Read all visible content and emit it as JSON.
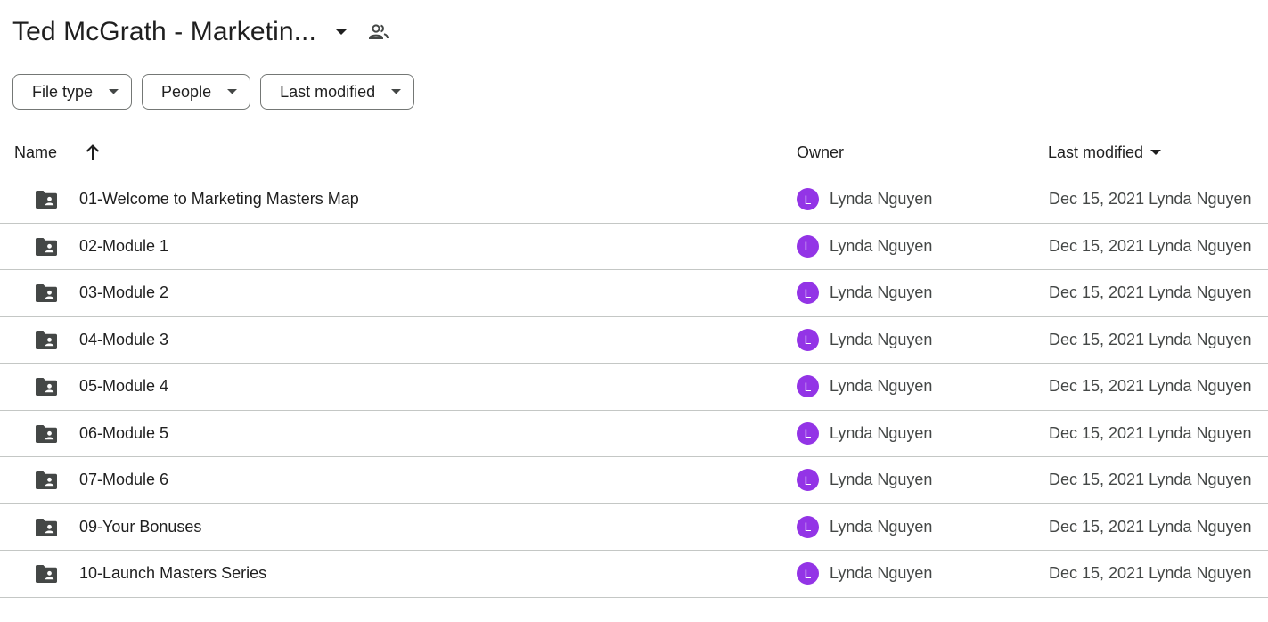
{
  "header": {
    "folder_title": "Ted McGrath - Marketin...",
    "title_dropdown_icon": "arrow-drop-down-icon",
    "shared_icon": "people-icon"
  },
  "filters": [
    {
      "label": "File type",
      "icon": "arrow-drop-down-icon"
    },
    {
      "label": "People",
      "icon": "arrow-drop-down-icon"
    },
    {
      "label": "Last modified",
      "icon": "arrow-drop-down-icon"
    }
  ],
  "columns": {
    "name": "Name",
    "name_sort_icon": "arrow-upward-icon",
    "owner": "Owner",
    "last_modified": "Last modified",
    "last_modified_icon": "arrow-drop-down-icon"
  },
  "files": [
    {
      "name": "01-Welcome to Marketing Masters Map",
      "avatar_letter": "L",
      "owner": "Lynda Nguyen",
      "modified": "Dec 15, 2021 Lynda Nguyen"
    },
    {
      "name": "02-Module 1",
      "avatar_letter": "L",
      "owner": "Lynda Nguyen",
      "modified": "Dec 15, 2021 Lynda Nguyen"
    },
    {
      "name": "03-Module 2",
      "avatar_letter": "L",
      "owner": "Lynda Nguyen",
      "modified": "Dec 15, 2021 Lynda Nguyen"
    },
    {
      "name": "04-Module 3",
      "avatar_letter": "L",
      "owner": "Lynda Nguyen",
      "modified": "Dec 15, 2021 Lynda Nguyen"
    },
    {
      "name": "05-Module 4",
      "avatar_letter": "L",
      "owner": "Lynda Nguyen",
      "modified": "Dec 15, 2021 Lynda Nguyen"
    },
    {
      "name": "06-Module 5",
      "avatar_letter": "L",
      "owner": "Lynda Nguyen",
      "modified": "Dec 15, 2021 Lynda Nguyen"
    },
    {
      "name": "07-Module 6",
      "avatar_letter": "L",
      "owner": "Lynda Nguyen",
      "modified": "Dec 15, 2021 Lynda Nguyen"
    },
    {
      "name": "09-Your Bonuses",
      "avatar_letter": "L",
      "owner": "Lynda Nguyen",
      "modified": "Dec 15, 2021 Lynda Nguyen"
    },
    {
      "name": "10-Launch Masters Series",
      "avatar_letter": "L",
      "owner": "Lynda Nguyen",
      "modified": "Dec 15, 2021 Lynda Nguyen"
    }
  ],
  "colors": {
    "avatar_bg": "#9334e6",
    "folder_icon": "#444746",
    "divider": "#c4c7c5",
    "text_primary": "#1f1f1f",
    "text_secondary": "#444746"
  }
}
